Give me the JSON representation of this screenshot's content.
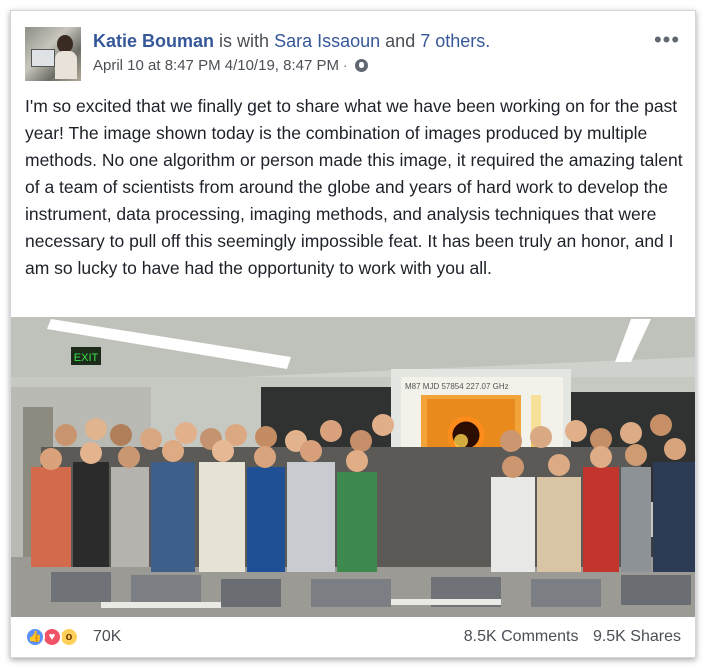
{
  "post": {
    "author": "Katie Bouman",
    "with_text": "is with",
    "tagged_person": "Sara Issaoun",
    "and_text": "and",
    "others_link": "7 others.",
    "timestamp": "April 10 at 8:47 PM 4/10/19, 8:47 PM",
    "separator": "·",
    "privacy_icon": "globe-icon",
    "more_icon": "•••",
    "body": "I'm so excited that we finally get to share what we have been working on for the past year! The image shown today is the combination of images produced by multiple methods. No one algorithm or person made this image, it required the amazing talent of a team of scientists from around the globe and years of hard work to develop the instrument, data processing, imaging methods, and analysis techniques that were necessary to pull off this seemingly impossible feat. It has been truly an honor, and I am so lucky to have had the opportunity to work with you all."
  },
  "photo": {
    "exit_sign": "EXIT",
    "screen_caption": "M87 MJD 57854 227.07 GHz"
  },
  "footer": {
    "reaction_icons": [
      "like-icon",
      "love-icon",
      "wow-icon"
    ],
    "like_glyph": "👍",
    "love_glyph": "♥",
    "wow_glyph": "o",
    "reaction_count": "70K",
    "comments": "8.5K Comments",
    "shares": "9.5K Shares"
  },
  "colors": {
    "link": "#365899",
    "text": "#1d2129",
    "meta": "#616770",
    "like": "#5890ff",
    "love": "#f25268",
    "wow": "#fed05a"
  }
}
